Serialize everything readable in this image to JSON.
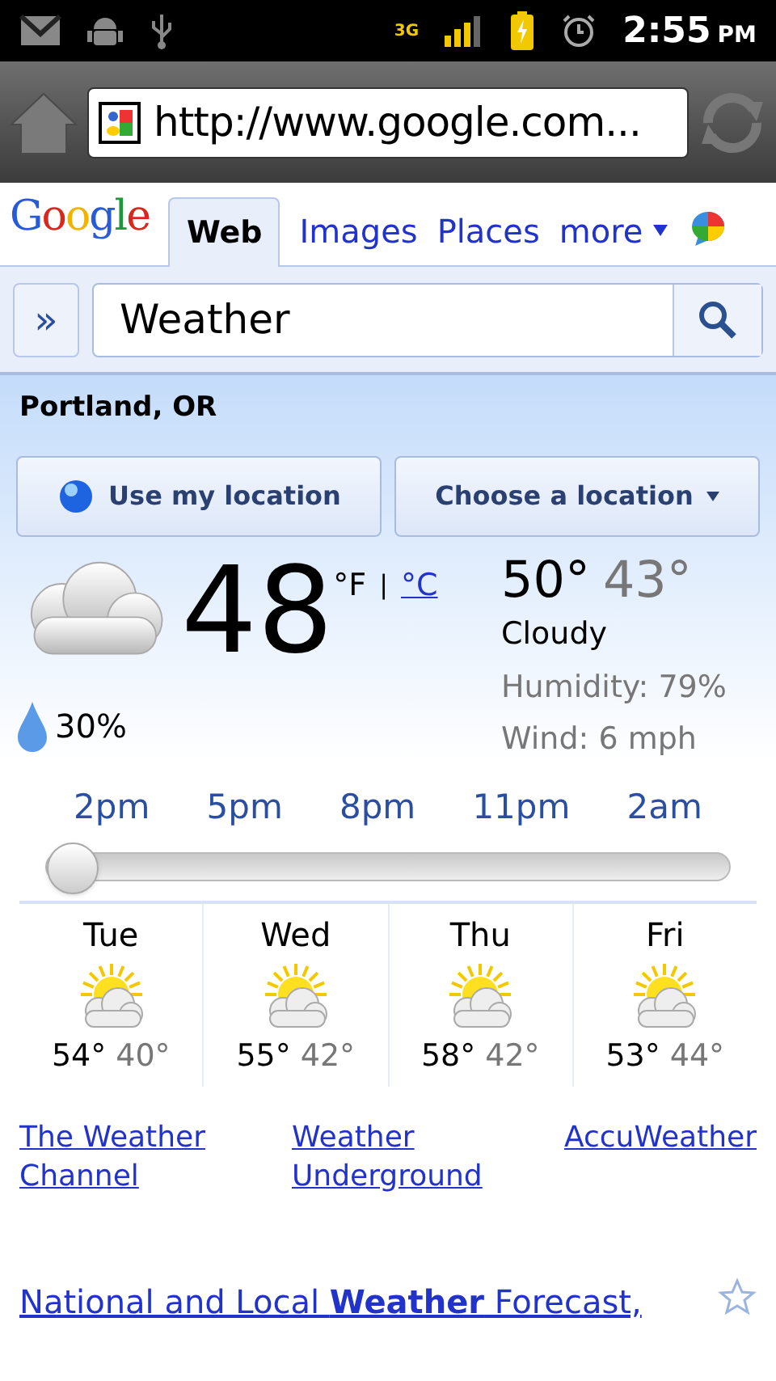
{
  "status_bar": {
    "network": "3G",
    "time": "2:55",
    "ampm": "PM"
  },
  "browser": {
    "url": "http://www.google.com..."
  },
  "google_bar": {
    "logo": "Google",
    "tabs": [
      {
        "label": "Web",
        "selected": true,
        "kind": "tab"
      },
      {
        "label": "Images",
        "selected": false,
        "kind": "tab"
      },
      {
        "label": "Places",
        "selected": false,
        "kind": "tab"
      },
      {
        "label": "more",
        "selected": false,
        "kind": "dropdown"
      }
    ]
  },
  "search": {
    "expand": "»",
    "value": "Weather"
  },
  "weather": {
    "location": "Portland, OR",
    "buttons": [
      {
        "label": "Use my location",
        "kind": "locate"
      },
      {
        "label": "Choose a location",
        "kind": "dropdown"
      }
    ],
    "temperature": "48",
    "unit_f": "°F",
    "separator": "|",
    "unit_c": "°C",
    "high": "50°",
    "low": "43°",
    "condition": "Cloudy",
    "humidity": "Humidity: 79%",
    "wind": "Wind: 6 mph",
    "precipitation": "30%",
    "hours": [
      "2pm",
      "5pm",
      "8pm",
      "11pm",
      "2am"
    ],
    "slider": {
      "level": 0
    },
    "forecast": [
      {
        "day": "Tue",
        "high": "54°",
        "low": "40°"
      },
      {
        "day": "Wed",
        "high": "55°",
        "low": "42°"
      },
      {
        "day": "Thu",
        "high": "58°",
        "low": "42°"
      },
      {
        "day": "Fri",
        "high": "53°",
        "low": "44°"
      }
    ],
    "sources": [
      "The Weather Channel",
      "Weather Underground",
      "AccuWeather"
    ]
  },
  "results": [
    {
      "title": "National and Local **Weather** Forecast,",
      "starred": false
    }
  ]
}
